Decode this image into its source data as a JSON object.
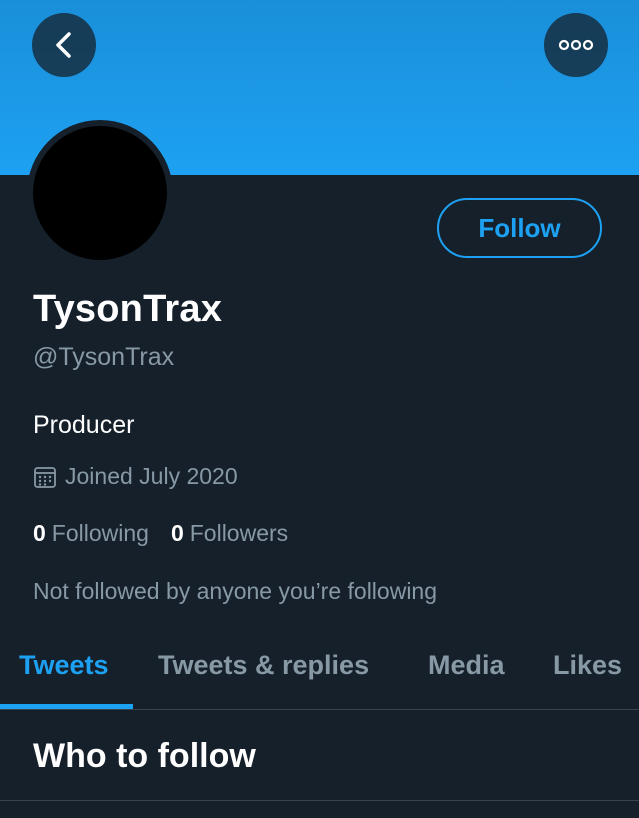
{
  "header": {
    "back_icon": "chevron-left-icon",
    "more_icon": "more-horizontal-icon"
  },
  "profile": {
    "display_name": "TysonTrax",
    "handle": "@TysonTrax",
    "bio": "Producer",
    "joined": "Joined July 2020",
    "follow_label": "Follow",
    "following_count": "0",
    "following_label": "Following",
    "followers_count": "0",
    "followers_label": "Followers",
    "not_followed_text": "Not followed by anyone you’re following"
  },
  "tabs": [
    {
      "label": "Tweets",
      "active": true
    },
    {
      "label": "Tweets & replies",
      "active": false
    },
    {
      "label": "Media",
      "active": false
    },
    {
      "label": "Likes",
      "active": false
    }
  ],
  "section": {
    "title": "Who to follow"
  },
  "colors": {
    "accent": "#1da1f2",
    "background": "#15202b",
    "secondary_text": "#8899a6",
    "divider": "#38444d"
  }
}
